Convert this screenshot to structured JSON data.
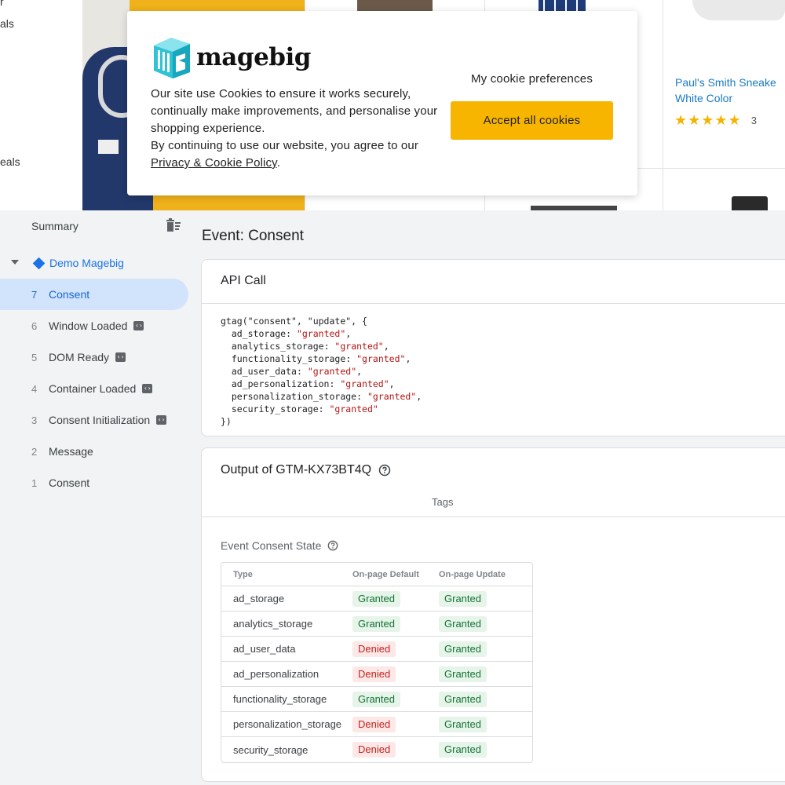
{
  "store": {
    "nav_fragments": [
      "r",
      "als",
      "eals"
    ],
    "product": {
      "name_line1": "Paul's Smith Sneake",
      "name_line2": "White Color",
      "stars": "★★★★★",
      "review_count": "3"
    }
  },
  "cookie_banner": {
    "logo_text": "magebig",
    "message_line": "Our site use Cookies to ensure it works securely, continually make improvements, and personalise your shopping experience.",
    "continue_text": "By continuing to use our website, you agree to our ",
    "policy_link": "Privacy & Cookie Policy",
    "policy_suffix": ".",
    "preferences_label": "My cookie preferences",
    "accept_label": "Accept all cookies",
    "accent_color": "#f8b500"
  },
  "debugger": {
    "summary_label": "Summary",
    "container_name": "Demo Magebig",
    "events": [
      {
        "num": "7",
        "label": "Consent",
        "selected": true,
        "badge": false
      },
      {
        "num": "6",
        "label": "Window Loaded",
        "selected": false,
        "badge": true
      },
      {
        "num": "5",
        "label": "DOM Ready",
        "selected": false,
        "badge": true
      },
      {
        "num": "4",
        "label": "Container Loaded",
        "selected": false,
        "badge": true
      },
      {
        "num": "3",
        "label": "Consent Initialization",
        "selected": false,
        "badge": true
      },
      {
        "num": "2",
        "label": "Message",
        "selected": false,
        "badge": false
      },
      {
        "num": "1",
        "label": "Consent",
        "selected": false,
        "badge": false
      }
    ],
    "event_title": "Event: Consent",
    "api_call": {
      "header": "API Call",
      "code_open": "gtag(\"consent\", \"update\", {",
      "entries": [
        {
          "key": "ad_storage",
          "value": "\"granted\"",
          "sep": ","
        },
        {
          "key": "analytics_storage",
          "value": "\"granted\"",
          "sep": ","
        },
        {
          "key": "functionality_storage",
          "value": "\"granted\"",
          "sep": ","
        },
        {
          "key": "ad_user_data",
          "value": "\"granted\"",
          "sep": ","
        },
        {
          "key": "ad_personalization",
          "value": "\"granted\"",
          "sep": ","
        },
        {
          "key": "personalization_storage",
          "value": "\"granted\"",
          "sep": ","
        },
        {
          "key": "security_storage",
          "value": "\"granted\"",
          "sep": ""
        }
      ],
      "code_close": "})"
    },
    "output": {
      "title": "Output of GTM-KX73BT4Q",
      "tags_tab": "Tags",
      "consent_state_label": "Event Consent State",
      "table": {
        "headers": [
          "Type",
          "On-page Default",
          "On-page Update"
        ],
        "rows": [
          {
            "type": "ad_storage",
            "default": "Granted",
            "update": "Granted"
          },
          {
            "type": "analytics_storage",
            "default": "Granted",
            "update": "Granted"
          },
          {
            "type": "ad_user_data",
            "default": "Denied",
            "update": "Granted"
          },
          {
            "type": "ad_personalization",
            "default": "Denied",
            "update": "Granted"
          },
          {
            "type": "functionality_storage",
            "default": "Granted",
            "update": "Granted"
          },
          {
            "type": "personalization_storage",
            "default": "Denied",
            "update": "Granted"
          },
          {
            "type": "security_storage",
            "default": "Denied",
            "update": "Granted"
          }
        ]
      }
    },
    "colors": {
      "granted_bg": "#e6f4ea",
      "granted_text": "#137333",
      "denied_bg": "#fce8e6",
      "denied_text": "#c5221f",
      "selected_bg": "#d2e3fc",
      "accent_blue": "#1a73e8"
    }
  }
}
